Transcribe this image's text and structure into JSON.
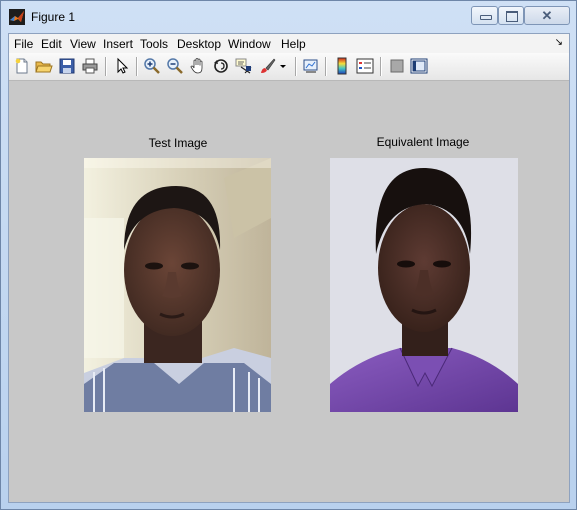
{
  "window": {
    "title": "Figure 1",
    "close_glyph": "✕"
  },
  "menu": {
    "items": [
      "File",
      "Edit",
      "View",
      "Insert",
      "Tools",
      "Desktop",
      "Window",
      "Help"
    ],
    "overflow_glyph": "↘"
  },
  "toolbar": {
    "icons": [
      "new-figure-icon",
      "open-file-icon",
      "save-icon",
      "print-icon",
      "edit-plot-arrow-icon",
      "zoom-in-icon",
      "zoom-out-icon",
      "pan-hand-icon",
      "rotate-3d-icon",
      "data-cursor-icon",
      "brush-icon",
      "brush-dropdown-icon",
      "link-plot-icon",
      "colorbar-icon",
      "legend-icon",
      "hide-plot-tools-icon",
      "show-plot-tools-icon"
    ]
  },
  "figure": {
    "left_title": "Test Image",
    "right_title": "Equivalent Image",
    "background": "#c8c8c8"
  }
}
